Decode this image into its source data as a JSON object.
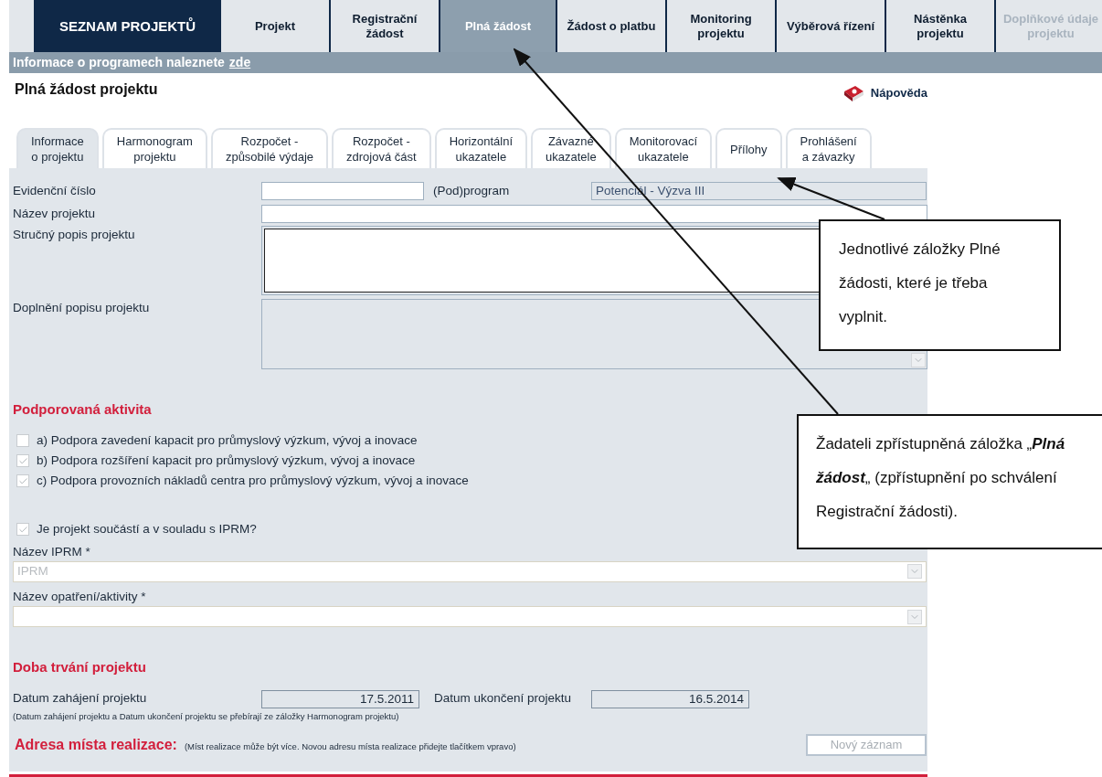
{
  "nav": [
    {
      "label": "SEZNAM PROJEKTŮ",
      "kind": "home"
    },
    {
      "label": "Projekt",
      "kind": "item",
      "selected": false,
      "disabled": false
    },
    {
      "label": "Registrační žádost",
      "kind": "item",
      "selected": false,
      "disabled": false
    },
    {
      "label": "Plná žádost",
      "kind": "item",
      "selected": true,
      "disabled": false
    },
    {
      "label": "Žádost o platbu",
      "kind": "item",
      "selected": false,
      "disabled": false
    },
    {
      "label": "Monitoring projektu",
      "kind": "item",
      "selected": false,
      "disabled": false
    },
    {
      "label": "Výběrová řízení",
      "kind": "item",
      "selected": false,
      "disabled": false
    },
    {
      "label": "Nástěnka projektu",
      "kind": "item",
      "selected": false,
      "disabled": false
    },
    {
      "label": "Doplňkové údaje projektu",
      "kind": "item",
      "selected": false,
      "disabled": true
    }
  ],
  "info_bar": {
    "text": "Informace o programech naleznete",
    "link": "zde"
  },
  "page_title": "Plná žádost projektu",
  "help": "Nápověda",
  "tabs": [
    {
      "lines": [
        "Informace",
        "o projektu"
      ],
      "selected": true
    },
    {
      "lines": [
        "Harmonogram",
        "projektu"
      ],
      "selected": false
    },
    {
      "lines": [
        "Rozpočet -",
        "způsobilé výdaje"
      ],
      "selected": false
    },
    {
      "lines": [
        "Rozpočet -",
        "zdrojová část"
      ],
      "selected": false
    },
    {
      "lines": [
        "Horizontální",
        "ukazatele"
      ],
      "selected": false
    },
    {
      "lines": [
        "Závazné",
        "ukazatele"
      ],
      "selected": false
    },
    {
      "lines": [
        "Monitorovací",
        "ukazatele"
      ],
      "selected": false
    },
    {
      "lines": [
        "Přílohy"
      ],
      "selected": false
    },
    {
      "lines": [
        "Prohlášení",
        "a závazky"
      ],
      "selected": false
    }
  ],
  "fields": {
    "evidencni_cislo": "Evidenční číslo",
    "podprogram_label": "(Pod)program",
    "podprogram_value": "Potenciál - Výzva III",
    "nazev_projektu": "Název projektu",
    "strucny_popis": "Stručný popis projektu",
    "doplneni_popisu": "Doplnění popisu projektu"
  },
  "activity": {
    "heading": "Podporovaná aktivita",
    "options": [
      {
        "label": "a) Podpora zavedení kapacit pro průmyslový výzkum, vývoj a inovace",
        "checked": false
      },
      {
        "label": "b) Podpora rozšíření kapacit pro průmyslový výzkum, vývoj a inovace",
        "checked": true
      },
      {
        "label": "c) Podpora provozních nákladů centra pro průmyslový výzkum, vývoj a inovace",
        "checked": true
      }
    ],
    "iprm_question": {
      "label": "Je projekt součástí a v souladu s IPRM?",
      "checked": true
    },
    "iprm_label": "Název IPRM *",
    "iprm_value": "IPRM",
    "measure_label": "Název opatření/aktivity *"
  },
  "duration": {
    "heading": "Doba trvání projektu",
    "start_label": "Datum zahájení projektu",
    "start_value": "17.5.2011",
    "end_label": "Datum ukončení projektu",
    "end_value": "16.5.2014",
    "note": "(Datum zahájení projektu a Datum ukončení projektu se přebírají ze záložky Harmonogram projektu)"
  },
  "address": {
    "heading": "Adresa místa realizace:",
    "note": "(Míst realizace může být více. Novou adresu místa realizace přidejte tlačítkem vpravo)",
    "button": "Nový záznam"
  },
  "callouts": [
    {
      "text": "Jednotlivé záložky Plné žádosti, které je třeba vyplnit."
    },
    {
      "text": "Žadateli zpřístupněná záložka „**Plná žádost**„ (zpřístupnění po schválení Registrační žádosti)."
    }
  ]
}
